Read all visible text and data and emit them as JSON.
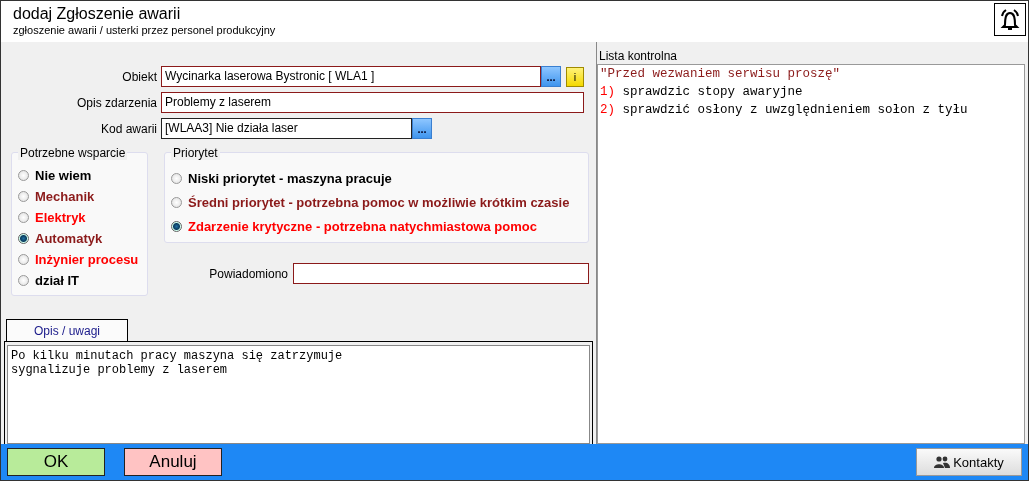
{
  "window": {
    "title": "dodaj Zgłoszenie awarii",
    "subtitle": "zgłoszenie awarii / usterki przez personel produkcyjny"
  },
  "form": {
    "fields": [
      {
        "kind": "picker",
        "label": "Obiekt",
        "value": "Wycinarka laserowa Bystronic [ WLA1 ]",
        "button": "...",
        "info": "i"
      },
      {
        "kind": "text",
        "label": "Opis zdarzenia",
        "value": "Problemy z laserem"
      },
      {
        "kind": "short-picker",
        "label": "Kod awarii",
        "value": "[WLAA3] Nie działa laser",
        "button": "..."
      }
    ]
  },
  "support": {
    "title": "Potrzebne wsparcie",
    "options": [
      {
        "label": "Nie wiem",
        "color": "#000000",
        "selected": false
      },
      {
        "label": "Mechanik",
        "color": "#8b1a1a",
        "selected": false
      },
      {
        "label": "Elektryk",
        "color": "#ff0000",
        "selected": false
      },
      {
        "label": "Automatyk",
        "color": "#8b1a1a",
        "selected": true
      },
      {
        "label": "Inżynier procesu",
        "color": "#ff0000",
        "selected": false
      },
      {
        "label": "dział IT",
        "color": "#000000",
        "selected": false
      }
    ]
  },
  "priority": {
    "title": "Priorytet",
    "options": [
      {
        "label": "Niski priorytet - maszyna pracuje",
        "color": "#000000",
        "selected": false
      },
      {
        "label": "Średni priorytet - potrzebna pomoc w możliwie krótkim czasie",
        "color": "#8b1a1a",
        "selected": false
      },
      {
        "label": "Zdarzenie krytyczne - potrzebna natychmiastowa pomoc",
        "color": "#ff0000",
        "selected": true
      }
    ]
  },
  "notified": {
    "label": "Powiadomiono"
  },
  "tabs": [
    {
      "label": "Opis / uwagi",
      "selected": true
    }
  ],
  "notes": {
    "value": "Po kilku minutach pracy maszyna się zatrzymuje\nsygnalizuje problemy z laserem"
  },
  "checklist": {
    "title": "Lista kontrolna",
    "lines": [
      {
        "kind": "quote",
        "text": "\"Przed wezwaniem serwisu proszę\""
      },
      {
        "kind": "item",
        "number": "1)",
        "text": "sprawdzic stopy awaryjne"
      },
      {
        "kind": "item",
        "number": "2)",
        "text": "sprawdzić osłony z uwzględnieniem sołon z tyłu"
      }
    ]
  },
  "buttons": [
    {
      "kind": "ok",
      "label": "OK"
    },
    {
      "kind": "cancel",
      "label": "Anuluj"
    },
    {
      "kind": "contacts",
      "label": "Kontakty"
    }
  ]
}
